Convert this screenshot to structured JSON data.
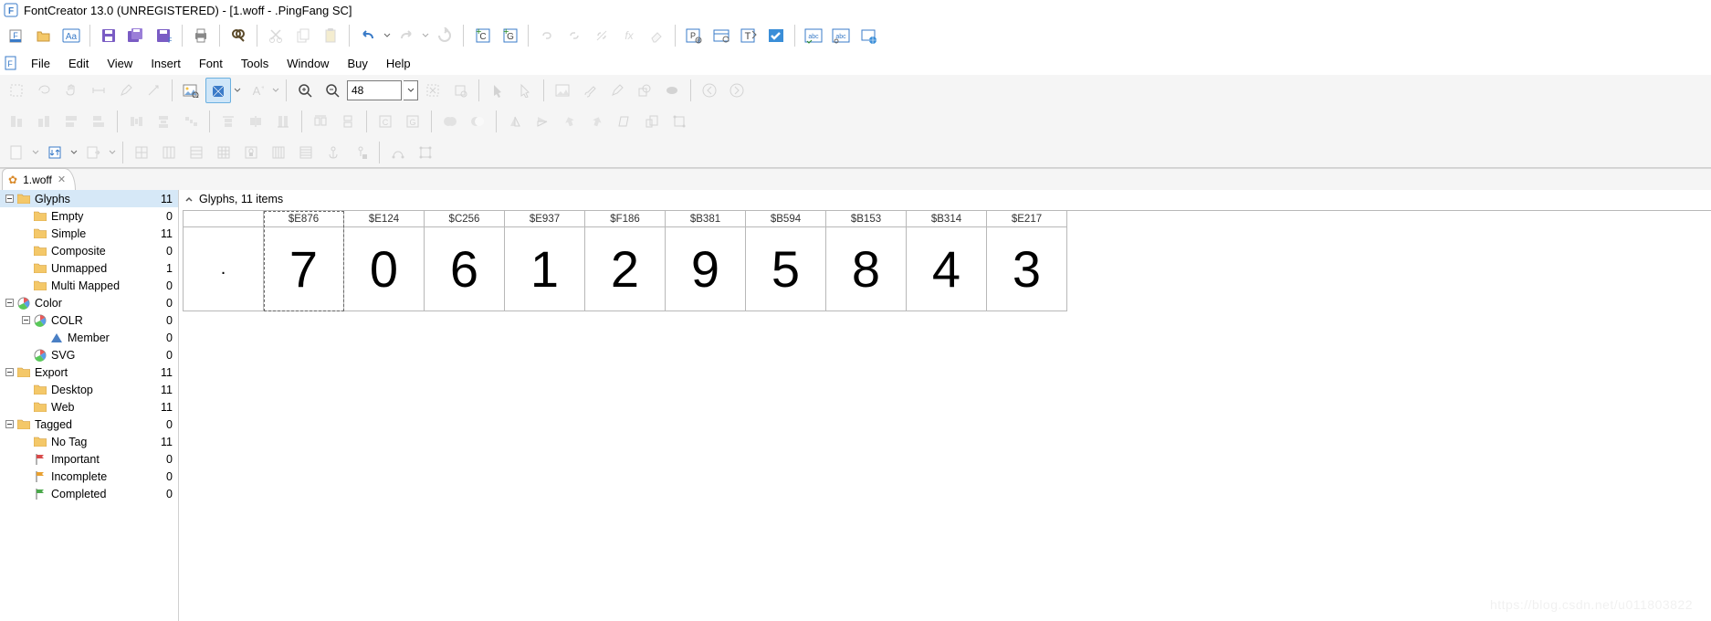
{
  "app": {
    "title": "FontCreator 13.0 (UNREGISTERED) - [1.woff - .PingFang SC]"
  },
  "menus": [
    "File",
    "Edit",
    "View",
    "Insert",
    "Font",
    "Tools",
    "Window",
    "Buy",
    "Help"
  ],
  "toolbar3": {
    "zoom_value": "48"
  },
  "doc_tab": {
    "label": "1.woff"
  },
  "tree": [
    {
      "depth": 0,
      "toggle": "minus",
      "icon": "folder",
      "label": "Glyphs",
      "count": 11,
      "selected": true
    },
    {
      "depth": 1,
      "toggle": "",
      "icon": "folder",
      "label": "Empty",
      "count": 0
    },
    {
      "depth": 1,
      "toggle": "",
      "icon": "folder",
      "label": "Simple",
      "count": 11
    },
    {
      "depth": 1,
      "toggle": "",
      "icon": "folder",
      "label": "Composite",
      "count": 0
    },
    {
      "depth": 1,
      "toggle": "",
      "icon": "folder",
      "label": "Unmapped",
      "count": 1
    },
    {
      "depth": 1,
      "toggle": "",
      "icon": "folder",
      "label": "Multi Mapped",
      "count": 0
    },
    {
      "depth": 0,
      "toggle": "minus",
      "icon": "pie",
      "label": "Color",
      "count": 0
    },
    {
      "depth": 1,
      "toggle": "minus",
      "icon": "pie",
      "label": "COLR",
      "count": 0
    },
    {
      "depth": 2,
      "toggle": "",
      "icon": "tri",
      "label": "Member",
      "count": 0
    },
    {
      "depth": 1,
      "toggle": "",
      "icon": "pie",
      "label": "SVG",
      "count": 0
    },
    {
      "depth": 0,
      "toggle": "minus",
      "icon": "folder",
      "label": "Export",
      "count": 11
    },
    {
      "depth": 1,
      "toggle": "",
      "icon": "folder",
      "label": "Desktop",
      "count": 11
    },
    {
      "depth": 1,
      "toggle": "",
      "icon": "folder",
      "label": "Web",
      "count": 11
    },
    {
      "depth": 0,
      "toggle": "minus",
      "icon": "folder",
      "label": "Tagged",
      "count": 0
    },
    {
      "depth": 1,
      "toggle": "",
      "icon": "folder",
      "label": "No Tag",
      "count": 11
    },
    {
      "depth": 1,
      "toggle": "",
      "icon": "flag-r",
      "label": "Important",
      "count": 0
    },
    {
      "depth": 1,
      "toggle": "",
      "icon": "flag-o",
      "label": "Incomplete",
      "count": 0
    },
    {
      "depth": 1,
      "toggle": "",
      "icon": "flag-g",
      "label": "Completed",
      "count": 0
    }
  ],
  "content": {
    "header": "Glyphs, 11 items"
  },
  "glyphs": [
    {
      "code": "",
      "char": ".",
      "dot": true,
      "selected": false
    },
    {
      "code": "$E876",
      "char": "7",
      "selected": true
    },
    {
      "code": "$E124",
      "char": "0"
    },
    {
      "code": "$C256",
      "char": "6"
    },
    {
      "code": "$E937",
      "char": "1"
    },
    {
      "code": "$F186",
      "char": "2"
    },
    {
      "code": "$B381",
      "char": "9"
    },
    {
      "code": "$B594",
      "char": "5"
    },
    {
      "code": "$B153",
      "char": "8"
    },
    {
      "code": "$B314",
      "char": "4"
    },
    {
      "code": "$E217",
      "char": "3"
    }
  ],
  "watermark": "https://blog.csdn.net/u011803822"
}
